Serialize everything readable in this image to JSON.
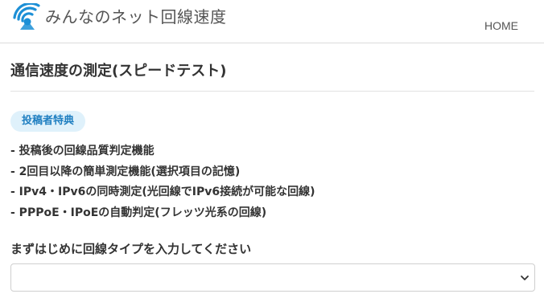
{
  "header": {
    "site_name": "みんなのネット回線速度",
    "logo_icon": "wifi-antenna-icon",
    "nav": {
      "home_label": "HOME"
    }
  },
  "main": {
    "title": "通信速度の測定(スピードテスト)",
    "badge": "投稿者特典",
    "benefits": [
      "- 投稿後の回線品質判定機能",
      "- 2回目以降の簡単測定機能(選択項目の記憶)",
      "- IPv4・IPv6の同時測定(光回線でIPv6接続が可能な回線)",
      "- PPPoE・IPoEの自動判定(フレッツ光系の回線)"
    ],
    "line_type": {
      "label": "まずはじめに回線タイプを入力してください",
      "selected_value": ""
    }
  },
  "colors": {
    "accent": "#1f7fc1",
    "badge_bg": "#dff1fb",
    "text": "#333333"
  }
}
